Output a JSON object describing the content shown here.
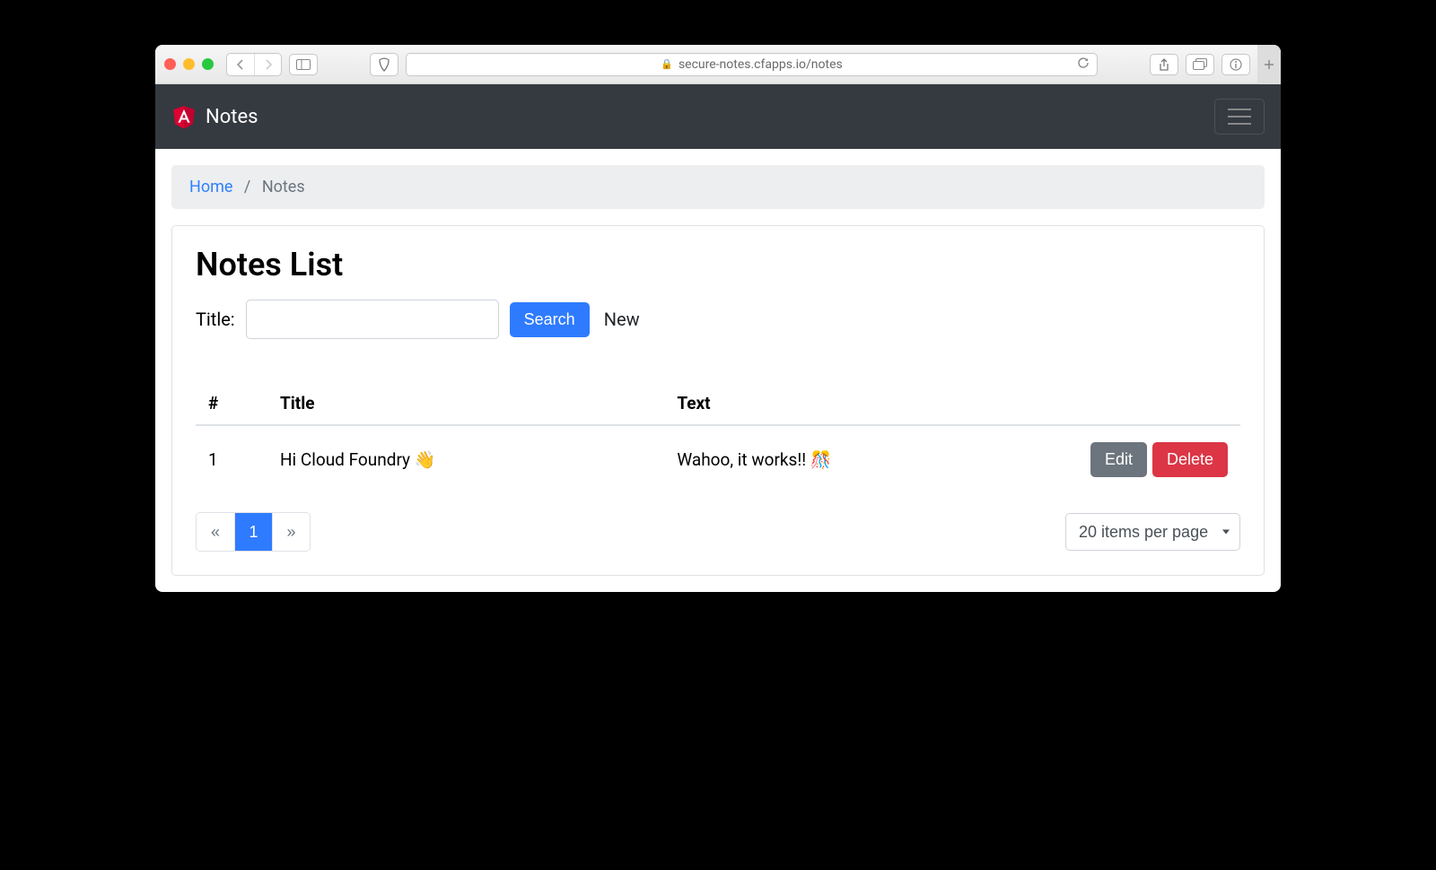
{
  "chrome": {
    "url": "secure-notes.cfapps.io/notes"
  },
  "navbar": {
    "brand": "Notes"
  },
  "breadcrumb": {
    "home": "Home",
    "current": "Notes"
  },
  "main": {
    "heading": "Notes List",
    "title_label": "Title:",
    "search_value": "",
    "search_button": "Search",
    "new_link": "New",
    "columns": {
      "id": "#",
      "title": "Title",
      "text": "Text"
    },
    "rows": [
      {
        "id": "1",
        "title": "Hi Cloud Foundry 👋",
        "text": "Wahoo, it works!! 🎊"
      }
    ],
    "edit_button": "Edit",
    "delete_button": "Delete",
    "pagination": {
      "prev": "«",
      "page": "1",
      "next": "»"
    },
    "per_page_selected": "20 items per page"
  }
}
